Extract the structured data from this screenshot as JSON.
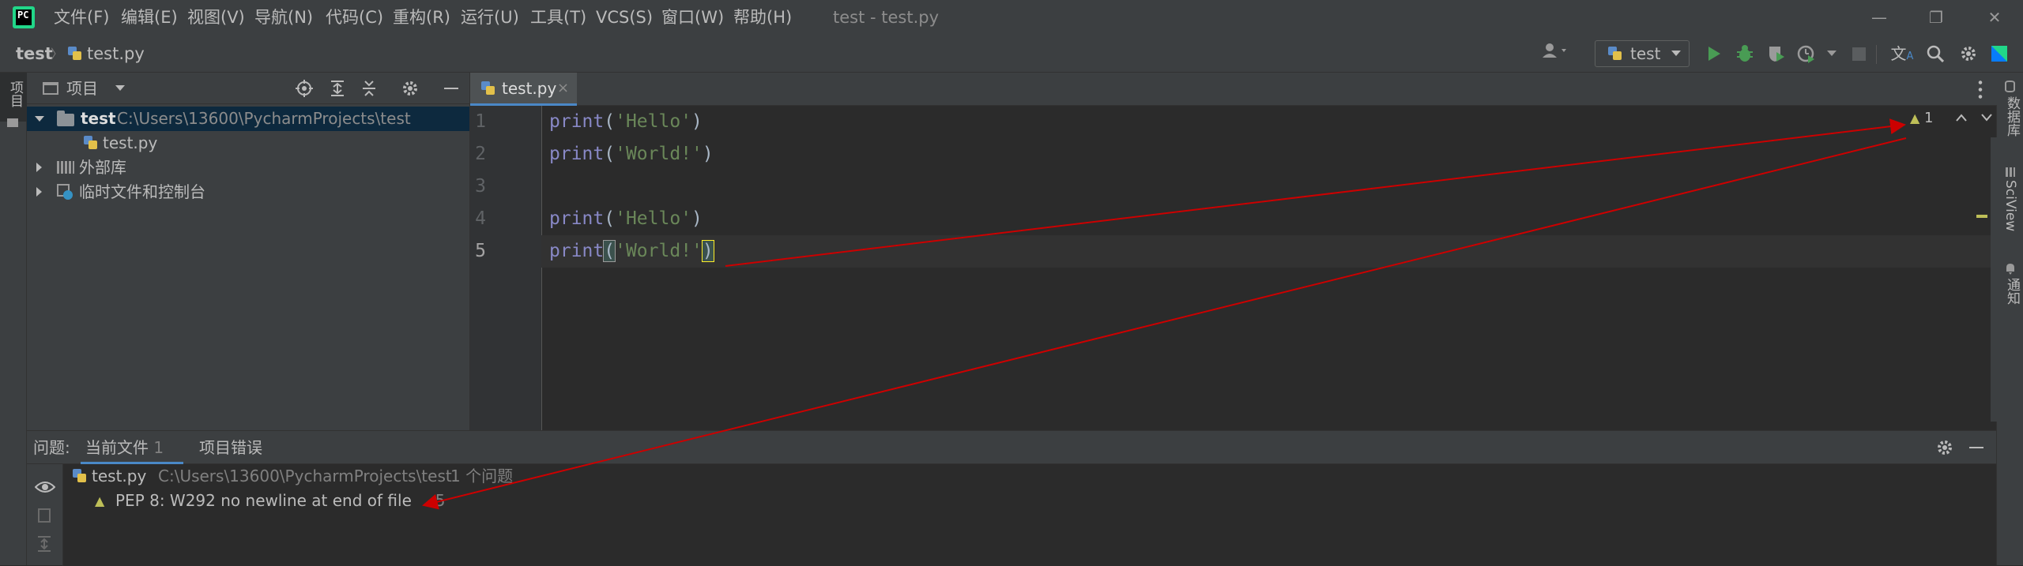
{
  "title_bar": {
    "logo_text": "PC",
    "menu": [
      "文件(F)",
      "编辑(E)",
      "视图(V)",
      "导航(N)",
      "代码(C)",
      "重构(R)",
      "运行(U)",
      "工具(T)",
      "VCS(S)",
      "窗口(W)",
      "帮助(H)"
    ],
    "window_title": "test - test.py",
    "minimize": "—",
    "restore": "❐",
    "close": "✕"
  },
  "nav_bar": {
    "project": "test",
    "separator": "〉",
    "file": "test.py",
    "run_config": "test"
  },
  "left_stripe": {
    "project_label": "项目"
  },
  "right_stripe": {
    "database": "数据库",
    "sciview": "SciView",
    "notifications": "通知"
  },
  "project_panel": {
    "title": "项目",
    "tree": {
      "root_name": "test",
      "root_path": "C:\\Users\\13600\\PycharmProjects\\test",
      "file": "test.py",
      "external_libs": "外部库",
      "scratches": "临时文件和控制台"
    }
  },
  "editor": {
    "tab_label": "test.py",
    "tab_close": "×",
    "warning_count": "1",
    "line_numbers": [
      "1",
      "2",
      "3",
      "4",
      "5"
    ],
    "lines": [
      {
        "fn": "print",
        "open": "(",
        "arg": "'Hello'",
        "close": ")"
      },
      {
        "fn": "print",
        "open": "(",
        "arg": "'World!'",
        "close": ")"
      },
      {
        "fn": "",
        "open": "",
        "arg": "",
        "close": ""
      },
      {
        "fn": "print",
        "open": "(",
        "arg": "'Hello'",
        "close": ")"
      },
      {
        "fn": "print",
        "open": "(",
        "arg": "'World!'",
        "close": ")"
      }
    ]
  },
  "problems": {
    "label": "问题:",
    "tabs": [
      {
        "label": "当前文件",
        "count": "1"
      },
      {
        "label": "项目错误",
        "count": ""
      }
    ],
    "file": "test.py",
    "path": "C:\\Users\\13600\\PycharmProjects\\test",
    "summary": "1 个问题",
    "issue": "PEP 8: W292 no newline at end of file",
    "issue_line": ":5"
  },
  "colors": {
    "accent": "#4a88c7",
    "warning": "#bebf58",
    "arrow": "#cc0000",
    "run_green": "#499c54"
  }
}
